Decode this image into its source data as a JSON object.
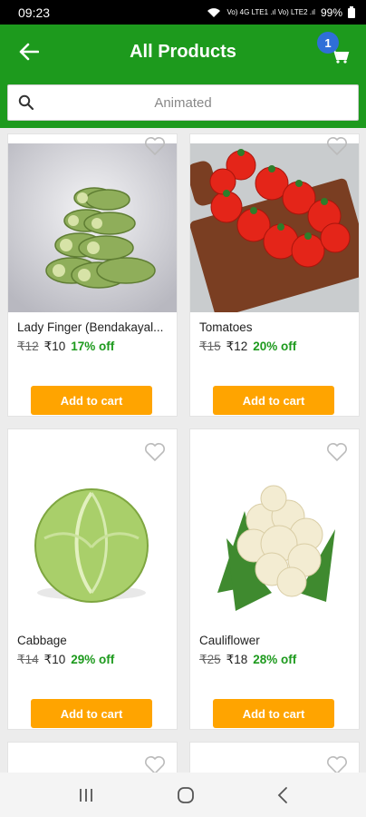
{
  "status": {
    "time": "09:23",
    "network": "Vo) 4G LTE1 .ıl Vo) LTE2 .ıl",
    "battery": "99%"
  },
  "app_bar": {
    "title": "All Products",
    "cart_count": "1"
  },
  "search": {
    "placeholder": "Animated"
  },
  "products": [
    {
      "name": "Lady Finger (Bendakayal...",
      "mrp": "₹12",
      "price": "₹10",
      "discount": "17% off",
      "cta": "Add to cart",
      "image": "okra-image"
    },
    {
      "name": "Tomatoes",
      "mrp": "₹15",
      "price": "₹12",
      "discount": "20% off",
      "cta": "Add to cart",
      "image": "tomatoes-image"
    },
    {
      "name": "Cabbage",
      "mrp": "₹14",
      "price": "₹10",
      "discount": "29% off",
      "cta": "Add to cart",
      "image": "cabbage-image"
    },
    {
      "name": "Cauliflower",
      "mrp": "₹25",
      "price": "₹18",
      "discount": "28% off",
      "cta": "Add to cart",
      "image": "cauliflower-image"
    }
  ],
  "colors": {
    "primary": "#1d9a1d",
    "accent": "#ffa400",
    "badge": "#2f6fd8"
  }
}
